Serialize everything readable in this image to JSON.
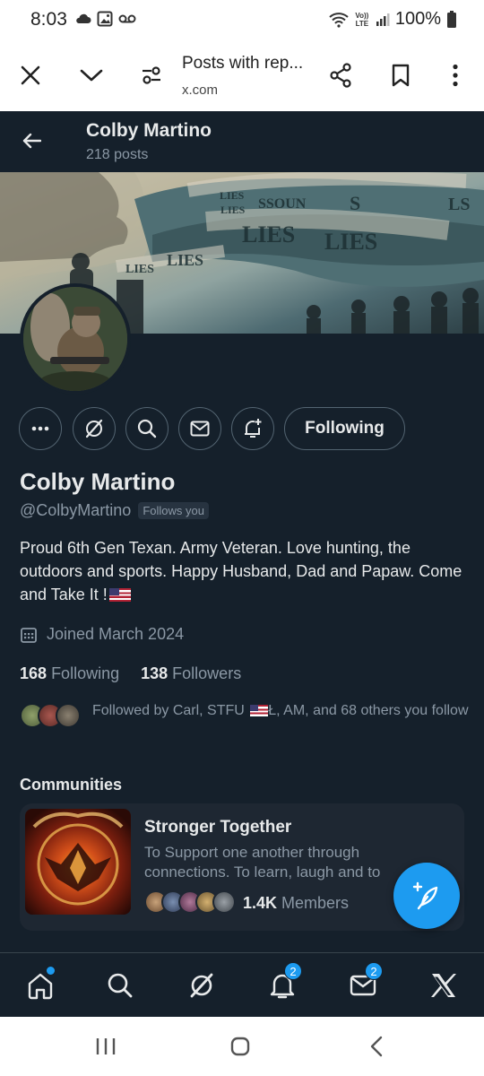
{
  "status_bar": {
    "time": "8:03",
    "battery": "100%",
    "icons_left": [
      "cloud-icon",
      "gallery-icon",
      "voicemail-icon"
    ],
    "icons_right": [
      "wifi-icon",
      "volte-icon",
      "signal-icon",
      "battery-icon"
    ],
    "volte_label": "Vo)) LTE"
  },
  "browser": {
    "title": "Posts with rep...",
    "url": "x.com",
    "icons": [
      "close-icon",
      "chevron-down-icon",
      "page-settings-icon",
      "share-icon",
      "bookmark-icon",
      "more-vertical-icon"
    ]
  },
  "header": {
    "name": "Colby Martino",
    "posts_count": "218 posts"
  },
  "profile": {
    "name": "Colby Martino",
    "handle": "@ColbyMartino",
    "follows_you_badge": "Follows you",
    "bio_text": "Proud 6th Gen Texan. Army Veteran. Love hunting, the outdoors and sports. Happy Husband, Dad and Papaw. Come and Take It !",
    "joined": "Joined March 2024",
    "following_count": "168",
    "following_label": "Following",
    "followers_count": "138",
    "followers_label": "Followers",
    "followed_by_prefix": "Followed by Carl, STFU ",
    "followed_by_suffix": "Ł, AM, and 68 others you follow"
  },
  "actions": {
    "following_button": "Following",
    "icons": [
      "more-horizontal-icon",
      "grok-icon",
      "search-icon",
      "message-icon",
      "notification-add-icon"
    ]
  },
  "communities": {
    "title": "Communities",
    "card": {
      "name": "Stronger Together",
      "description": "To Support one another through connections. To learn, laugh and to",
      "member_count": "1.4K",
      "member_label": "Members"
    }
  },
  "bottom_nav": {
    "items": [
      "home-icon",
      "search-icon",
      "grok-icon",
      "notifications-icon",
      "messages-icon",
      "x-logo-icon"
    ],
    "notifications_badge": "2",
    "messages_badge": "2"
  },
  "colors": {
    "background": "#15202b",
    "accent": "#1d9bf0",
    "text_primary": "#e7e9ea",
    "text_secondary": "#8b98a5",
    "border": "#536471"
  },
  "banner_words": [
    "LIES",
    "LIES",
    "LIES",
    "LIES",
    "LIES",
    "LIES",
    "SSOUN",
    "S",
    "LS"
  ]
}
